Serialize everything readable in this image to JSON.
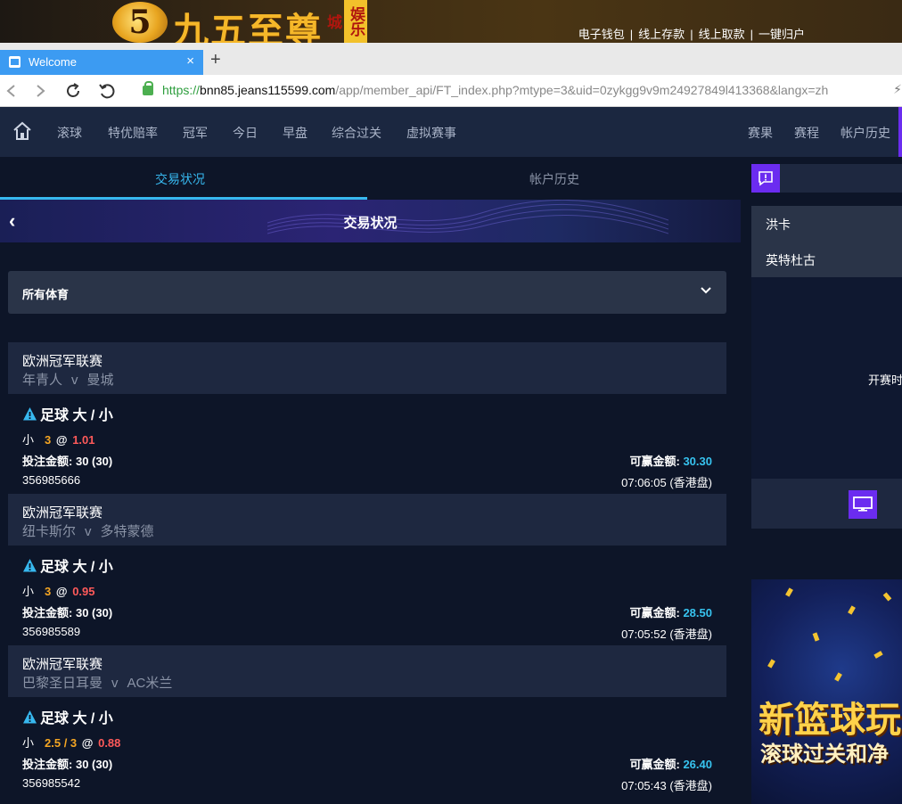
{
  "banner": {
    "logo_glyph": "5",
    "brand": "九五至尊",
    "brand_tag": "娱乐城",
    "links": [
      "电子钱包",
      "线上存款",
      "线上取款",
      "一键归户"
    ],
    "separator": "|"
  },
  "browser": {
    "tab_title": "Welcome",
    "tab_close": "×",
    "new_tab": "+",
    "url_proto": "https://",
    "url_host": "bnn85.jeans115599.com",
    "url_path": "/app/member_api/FT_index.php?mtype=3&uid=0zykgg9v9m24927849l413368&langx=zh",
    "url_extra": "⚡"
  },
  "nav": {
    "items": [
      "滚球",
      "特优赔率",
      "冠军",
      "今日",
      "早盘",
      "综合过关",
      "虚拟赛事"
    ],
    "right_items": [
      "赛果",
      "赛程",
      "帐户历史"
    ]
  },
  "subtabs": [
    "交易状况",
    "帐户历史"
  ],
  "hero": {
    "back": "‹",
    "title": "交易状况"
  },
  "filter": {
    "label": "所有体育"
  },
  "bets": [
    {
      "league": "欧洲冠军联赛",
      "home": "年青人",
      "vs": "v",
      "away": "曼城",
      "market": "足球 大 / 小",
      "selection": "小",
      "handicap": "3",
      "at": "@",
      "odds": "1.01",
      "stake_label": "投注金额:",
      "stake": "30 (30)",
      "win_label": "可赢金额:",
      "win": "30.30",
      "ticket": "356985666",
      "time": "07:06:05 (香港盘)"
    },
    {
      "league": "欧洲冠军联赛",
      "home": "纽卡斯尔",
      "vs": "v",
      "away": "多特蒙德",
      "market": "足球 大 / 小",
      "selection": "小",
      "handicap": "3",
      "at": "@",
      "odds": "0.95",
      "stake_label": "投注金额:",
      "stake": "30 (30)",
      "win_label": "可赢金额:",
      "win": "28.50",
      "ticket": "356985589",
      "time": "07:05:52 (香港盘)"
    },
    {
      "league": "欧洲冠军联赛",
      "home": "巴黎圣日耳曼",
      "vs": "v",
      "away": "AC米兰",
      "market": "足球 大 / 小",
      "selection": "小",
      "handicap": "2.5 / 3",
      "at": "@",
      "odds": "0.88",
      "stake_label": "投注金额:",
      "stake": "30 (30)",
      "win_label": "可赢金额:",
      "win": "26.40",
      "ticket": "356985542",
      "time": "07:05:43 (香港盘)"
    }
  ],
  "side": {
    "team1": "洪卡",
    "team2": "英特杜古",
    "video_text": "开赛时",
    "promo_line1": "新篮球玩",
    "promo_line2": "滚球过关和净"
  },
  "colors": {
    "accent": "#37b8ef",
    "purple": "#6b2cf0",
    "handicap": "#f5a623",
    "odds": "#ff5a5a",
    "win": "#37c3ef"
  }
}
